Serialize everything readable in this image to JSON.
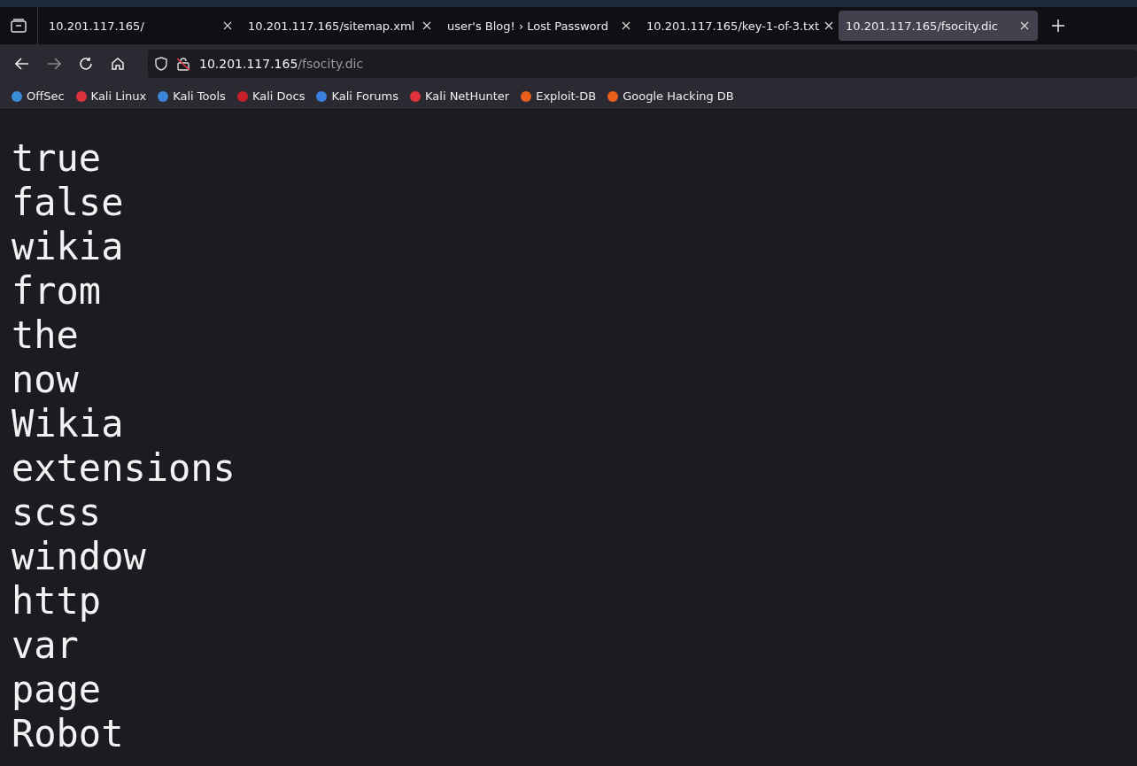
{
  "tabs": [
    {
      "label": "10.201.117.165/",
      "selected": false
    },
    {
      "label": "10.201.117.165/sitemap.xml",
      "selected": false
    },
    {
      "label": "user's Blog! › Lost Password",
      "selected": false
    },
    {
      "label": "10.201.117.165/key-1-of-3.txt",
      "selected": false
    },
    {
      "label": "10.201.117.165/fsocity.dic",
      "selected": true
    }
  ],
  "address": {
    "host": "10.201.117.165",
    "path": "/fsocity.dic"
  },
  "bookmarks": [
    {
      "label": "OffSec",
      "color": "#3b8fd9"
    },
    {
      "label": "Kali Linux",
      "color": "#e0323c"
    },
    {
      "label": "Kali Tools",
      "color": "#3a86d8"
    },
    {
      "label": "Kali Docs",
      "color": "#c8202a"
    },
    {
      "label": "Kali Forums",
      "color": "#3a7fe0"
    },
    {
      "label": "Kali NetHunter",
      "color": "#e0323c"
    },
    {
      "label": "Exploit-DB",
      "color": "#e8601c"
    },
    {
      "label": "Google Hacking DB",
      "color": "#e8601c"
    }
  ],
  "lines": [
    "true",
    "false",
    "wikia",
    "from",
    "the",
    "now",
    "Wikia",
    "extensions",
    "scss",
    "window",
    "http",
    "var",
    "page",
    "Robot"
  ]
}
